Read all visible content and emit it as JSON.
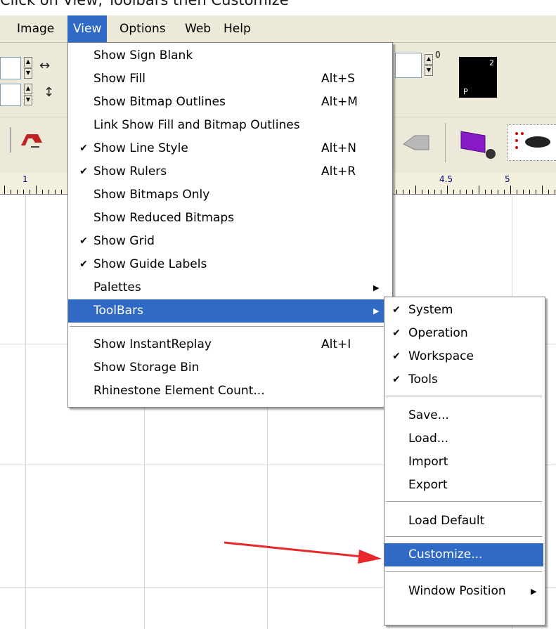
{
  "caption": "Click on View, Toolbars then Customize",
  "menubar": {
    "items": [
      "Image",
      "View",
      "Options",
      "Web",
      "Help"
    ]
  },
  "toolbar": {
    "spin_field_3_label": "0",
    "preview_glyph_top": "2",
    "preview_glyph_bottom": "P"
  },
  "ruler": {
    "labels": [
      "1",
      "4.5",
      "5"
    ]
  },
  "view_menu": {
    "items": [
      {
        "label": "Show Sign Blank",
        "checked": false,
        "shortcut": ""
      },
      {
        "label": "Show Fill",
        "checked": false,
        "shortcut": "Alt+S"
      },
      {
        "label": "Show Bitmap Outlines",
        "checked": false,
        "shortcut": "Alt+M"
      },
      {
        "label": "Link Show Fill and Bitmap Outlines",
        "checked": false,
        "shortcut": ""
      },
      {
        "label": "Show Line Style",
        "checked": true,
        "shortcut": "Alt+N"
      },
      {
        "label": "Show Rulers",
        "checked": true,
        "shortcut": "Alt+R"
      },
      {
        "label": "Show Bitmaps Only",
        "checked": false,
        "shortcut": ""
      },
      {
        "label": "Show Reduced Bitmaps",
        "checked": false,
        "shortcut": ""
      },
      {
        "label": "Show Grid",
        "checked": true,
        "shortcut": ""
      },
      {
        "label": "Show Guide Labels",
        "checked": true,
        "shortcut": ""
      },
      {
        "label": "Palettes",
        "checked": false,
        "shortcut": "",
        "submenu": true
      },
      {
        "label": "ToolBars",
        "checked": false,
        "shortcut": "",
        "submenu": true,
        "highlighted": true
      },
      {
        "label": "Show InstantReplay",
        "checked": false,
        "shortcut": "Alt+I"
      },
      {
        "label": "Show Storage Bin",
        "checked": false,
        "shortcut": ""
      },
      {
        "label": "Rhinestone Element Count...",
        "checked": false,
        "shortcut": ""
      }
    ],
    "check_glyph": "✔",
    "arrow_glyph": "▶"
  },
  "toolbars_submenu": {
    "items": [
      {
        "label": "System",
        "checked": true
      },
      {
        "label": "Operation",
        "checked": true
      },
      {
        "label": "Workspace",
        "checked": true
      },
      {
        "label": "Tools",
        "checked": true
      },
      {
        "label": "Save...",
        "checked": false
      },
      {
        "label": "Load...",
        "checked": false
      },
      {
        "label": "Import",
        "checked": false
      },
      {
        "label": "Export",
        "checked": false
      },
      {
        "label": "Load Default",
        "checked": false
      },
      {
        "label": "Customize...",
        "checked": false,
        "highlighted": true
      },
      {
        "label": "Window Position",
        "checked": false,
        "submenu": true
      }
    ]
  },
  "colors": {
    "highlight": "#316ac5",
    "menu_bg": "#ece9d8",
    "annotation_arrow": "#e8282a"
  }
}
